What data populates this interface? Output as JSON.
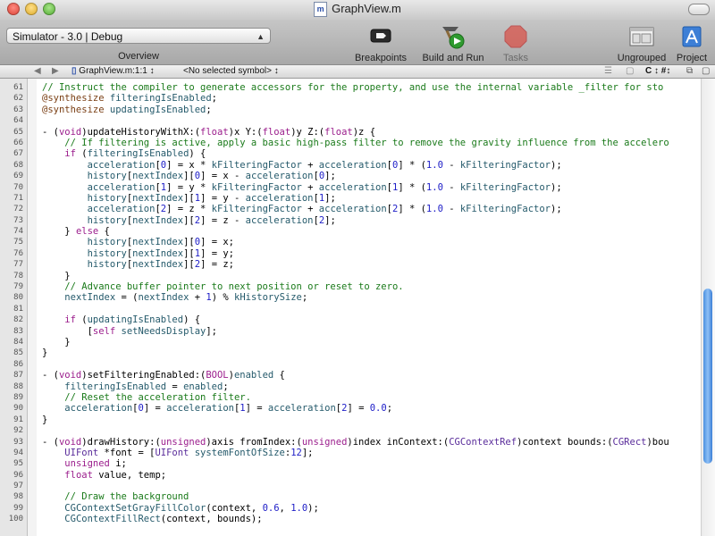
{
  "window": {
    "title": "GraphView.m",
    "file_badge": "m"
  },
  "toolbar": {
    "scheme": "Simulator - 3.0 | Debug",
    "overview_label": "Overview",
    "breakpoints_label": "Breakpoints",
    "build_run_label": "Build and Run",
    "tasks_label": "Tasks",
    "ungrouped_label": "Ungrouped",
    "project_label": "Project"
  },
  "navbar": {
    "file": "GraphView.m:1:1 ↕",
    "symbol": "<No selected symbol> ↕",
    "right_tools": "C ↕  #↕"
  },
  "colors": {
    "comment": "#1a7a1a",
    "keyword": "#9b1d8c",
    "type": "#5a2d9b",
    "number": "#2020c8",
    "identifier": "#255a6b",
    "scroll_thumb": "#4a8fe0"
  },
  "code_lines": [
    {
      "n": "61",
      "t": "// Instruct the compiler to generate accessors for the property, and use the internal variable _filter for sto"
    },
    {
      "n": "62",
      "t": "@synthesize filteringIsEnabled;"
    },
    {
      "n": "63",
      "t": "@synthesize updatingIsEnabled;"
    },
    {
      "n": "64",
      "t": ""
    },
    {
      "n": "65",
      "t": "- (void)updateHistoryWithX:(float)x Y:(float)y Z:(float)z {"
    },
    {
      "n": "66",
      "t": "    // If filtering is active, apply a basic high-pass filter to remove the gravity influence from the accelero"
    },
    {
      "n": "67",
      "t": "    if (filteringIsEnabled) {"
    },
    {
      "n": "68",
      "t": "        acceleration[0] = x * kFilteringFactor + acceleration[0] * (1.0 - kFilteringFactor);"
    },
    {
      "n": "69",
      "t": "        history[nextIndex][0] = x - acceleration[0];"
    },
    {
      "n": "70",
      "t": "        acceleration[1] = y * kFilteringFactor + acceleration[1] * (1.0 - kFilteringFactor);"
    },
    {
      "n": "71",
      "t": "        history[nextIndex][1] = y - acceleration[1];"
    },
    {
      "n": "72",
      "t": "        acceleration[2] = z * kFilteringFactor + acceleration[2] * (1.0 - kFilteringFactor);"
    },
    {
      "n": "73",
      "t": "        history[nextIndex][2] = z - acceleration[2];"
    },
    {
      "n": "74",
      "t": "    } else {"
    },
    {
      "n": "75",
      "t": "        history[nextIndex][0] = x;"
    },
    {
      "n": "76",
      "t": "        history[nextIndex][1] = y;"
    },
    {
      "n": "77",
      "t": "        history[nextIndex][2] = z;"
    },
    {
      "n": "78",
      "t": "    }"
    },
    {
      "n": "79",
      "t": "    // Advance buffer pointer to next position or reset to zero."
    },
    {
      "n": "80",
      "t": "    nextIndex = (nextIndex + 1) % kHistorySize;"
    },
    {
      "n": "81",
      "t": ""
    },
    {
      "n": "82",
      "t": "    if (updatingIsEnabled) {"
    },
    {
      "n": "83",
      "t": "        [self setNeedsDisplay];"
    },
    {
      "n": "84",
      "t": "    }"
    },
    {
      "n": "85",
      "t": "}"
    },
    {
      "n": "86",
      "t": ""
    },
    {
      "n": "87",
      "t": "- (void)setFilteringEnabled:(BOOL)enabled {"
    },
    {
      "n": "88",
      "t": "    filteringIsEnabled = enabled;"
    },
    {
      "n": "89",
      "t": "    // Reset the acceleration filter."
    },
    {
      "n": "90",
      "t": "    acceleration[0] = acceleration[1] = acceleration[2] = 0.0;"
    },
    {
      "n": "91",
      "t": "}"
    },
    {
      "n": "92",
      "t": ""
    },
    {
      "n": "93",
      "t": "- (void)drawHistory:(unsigned)axis fromIndex:(unsigned)index inContext:(CGContextRef)context bounds:(CGRect)bou"
    },
    {
      "n": "94",
      "t": "    UIFont *font = [UIFont systemFontOfSize:12];"
    },
    {
      "n": "95",
      "t": "    unsigned i;"
    },
    {
      "n": "96",
      "t": "    float value, temp;"
    },
    {
      "n": "97",
      "t": ""
    },
    {
      "n": "98",
      "t": "    // Draw the background"
    },
    {
      "n": "99",
      "t": "    CGContextSetGrayFillColor(context, 0.6, 1.0);"
    },
    {
      "n": "100",
      "t": "    CGContextFillRect(context, bounds);"
    }
  ]
}
